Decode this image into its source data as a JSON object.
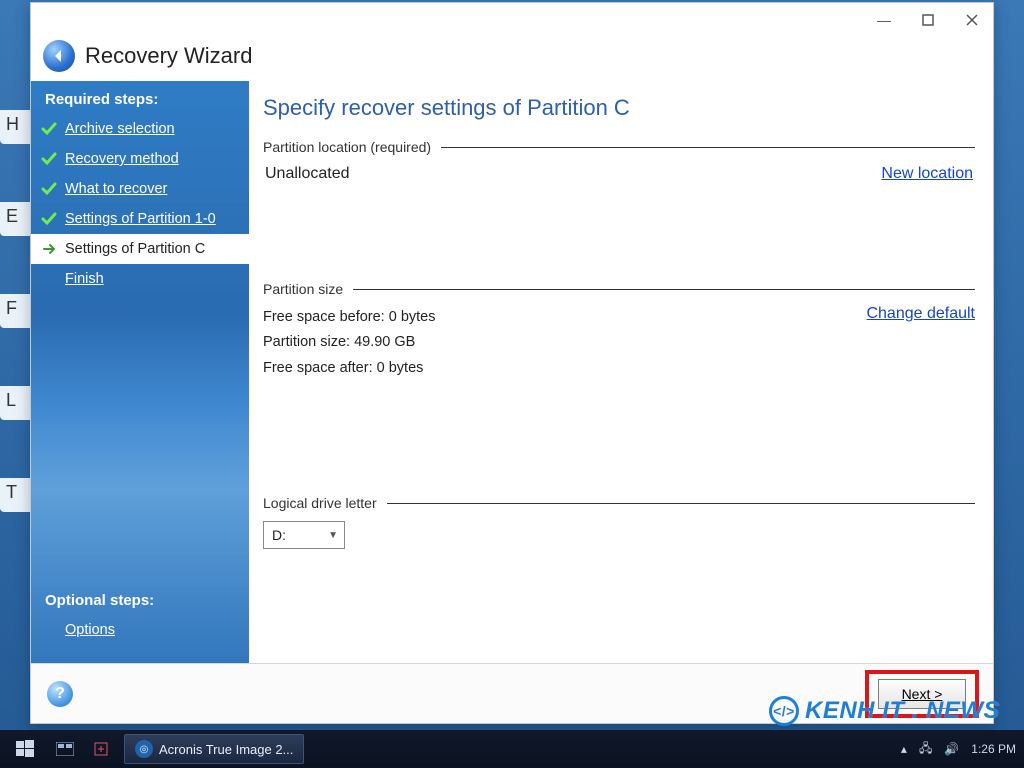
{
  "window": {
    "title": "Recovery Wizard"
  },
  "sidebar": {
    "required_title": "Required steps:",
    "optional_title": "Optional steps:",
    "steps": [
      {
        "label": "Archive selection",
        "done": true
      },
      {
        "label": "Recovery method",
        "done": true
      },
      {
        "label": "What to recover",
        "done": true
      },
      {
        "label": "Settings of Partition 1-0",
        "done": true
      },
      {
        "label": "Settings of Partition C",
        "current": true
      },
      {
        "label": "Finish"
      }
    ],
    "optional": [
      {
        "label": "Options"
      }
    ]
  },
  "content": {
    "page_title": "Specify recover settings of Partition C",
    "loc_header": "Partition location (required)",
    "loc_value": "Unallocated",
    "new_location_link": "New location",
    "size_header": "Partition size",
    "free_before_label": "Free space before:",
    "free_before_value": "0 bytes",
    "psize_label": "Partition size:",
    "psize_value": "49.90 GB",
    "free_after_label": "Free space after:",
    "free_after_value": "0 bytes",
    "change_default_link": "Change default",
    "drive_header": "Logical drive letter",
    "drive_value": "D:"
  },
  "footer": {
    "next_label": "Next >"
  },
  "taskbar": {
    "app_label": "Acronis True Image 2...",
    "clock": "1:26 PM"
  },
  "watermark": "KENH IT . NEWS",
  "phantom": {
    "a": "H",
    "b": "E",
    "c": "F",
    "d": "L",
    "e": "T"
  }
}
